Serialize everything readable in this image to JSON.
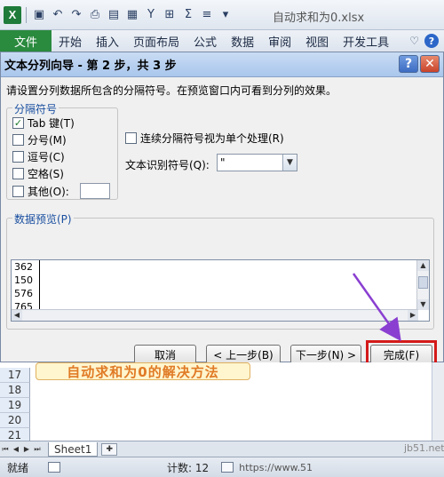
{
  "app": {
    "quick_access_icons": [
      "excel-logo",
      "save-icon",
      "undo-icon",
      "redo-icon",
      "print-preview-icon",
      "format-painter-icon",
      "calculator-icon",
      "filter-icon",
      "borders-icon",
      "sum-icon",
      "align-icon",
      "more-icon"
    ],
    "sum_symbol": "Σ",
    "file_title": "自动求和为0.xlsx",
    "logo_letter": "X"
  },
  "ribbon": {
    "file_tab": "文件",
    "tabs": [
      "开始",
      "插入",
      "页面布局",
      "公式",
      "数据",
      "审阅",
      "视图",
      "开发工具"
    ],
    "help_glyph": "?"
  },
  "dialog": {
    "title": "文本分列向导 - 第 2 步，共 3 步",
    "help_btn": "?",
    "close_btn": "✕",
    "instruction": "请设置分列数据所包含的分隔符号。在预览窗口内可看到分列的效果。",
    "delimiters_group": "分隔符号",
    "delimiters": [
      {
        "label": "Tab 键(T)",
        "checked": true
      },
      {
        "label": "分号(M)",
        "checked": false
      },
      {
        "label": "逗号(C)",
        "checked": false
      },
      {
        "label": "空格(S)",
        "checked": false
      },
      {
        "label": "其他(O):",
        "checked": false
      }
    ],
    "other_value": "",
    "consecutive_label": "连续分隔符号视为单个处理(R)",
    "consecutive_checked": false,
    "qualifier_label": "文本识别符号(Q):",
    "qualifier_value": "\"",
    "preview_group": "数据预览(P)",
    "preview_rows": [
      "362",
      "150",
      "576",
      "765"
    ],
    "buttons": {
      "cancel": "取消",
      "back": "< 上一步(B)",
      "next": "下一步(N) >",
      "finish": "完成(F)"
    },
    "check_glyph": "✓"
  },
  "sheet": {
    "rows": [
      "17",
      "18",
      "19",
      "20",
      "21"
    ],
    "banner_text": "自动求和为0的解决方法",
    "tab_name": "Sheet1"
  },
  "status": {
    "ready": "就绪",
    "count": "计数: 12",
    "zoom": "https://www.51"
  },
  "watermark": "jb51.net"
}
